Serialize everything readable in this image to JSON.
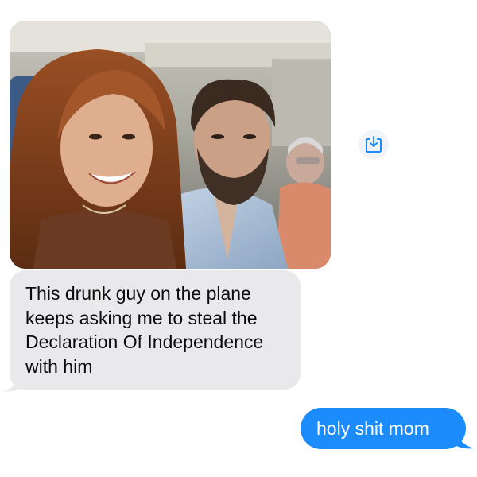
{
  "conversation": {
    "messages": [
      {
        "type": "image",
        "direction": "incoming",
        "icon": "photo-attachment"
      },
      {
        "type": "text",
        "direction": "incoming",
        "lines": [
          "This drunk guy on the plane",
          "keeps asking me to steal the",
          "Declaration Of Independence",
          "with him"
        ]
      },
      {
        "type": "text",
        "direction": "outgoing",
        "text": "holy shit mom"
      }
    ],
    "save_action_icon": "download-to-tray-icon"
  },
  "colors": {
    "incoming_bubble": "#e9e9eb",
    "outgoing_bubble": "#1c8cfc",
    "accent_icon": "#1c8cfc"
  }
}
